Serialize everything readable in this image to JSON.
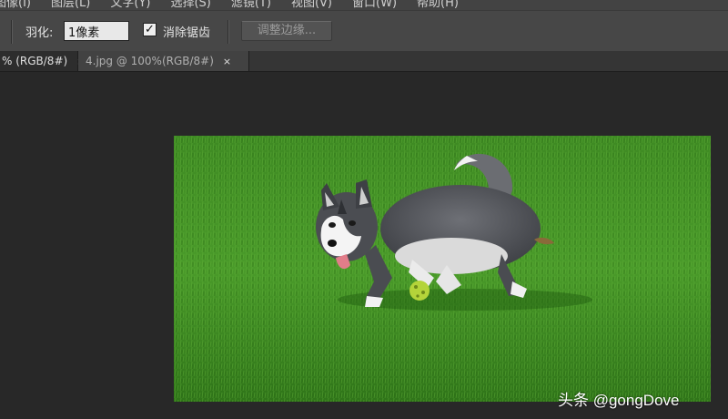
{
  "menu": {
    "items": [
      "图像(I)",
      "图层(L)",
      "文字(Y)",
      "选择(S)",
      "滤镜(T)",
      "视图(V)",
      "窗口(W)",
      "帮助(H)"
    ]
  },
  "options": {
    "feather_label": "羽化:",
    "feather_value": "1像素",
    "antialias_checked": true,
    "antialias_label": "消除锯齿",
    "refine_edge_label": "调整边缘..."
  },
  "tabs": [
    {
      "label": "% (RGB/8#)",
      "close": "×",
      "active": true
    },
    {
      "label": "4.jpg @ 100%(RGB/8#)",
      "close": "×",
      "active": false
    }
  ],
  "canvas": {
    "image": "husky-puppy-on-grass",
    "watermark": "头条 @gongDove"
  }
}
